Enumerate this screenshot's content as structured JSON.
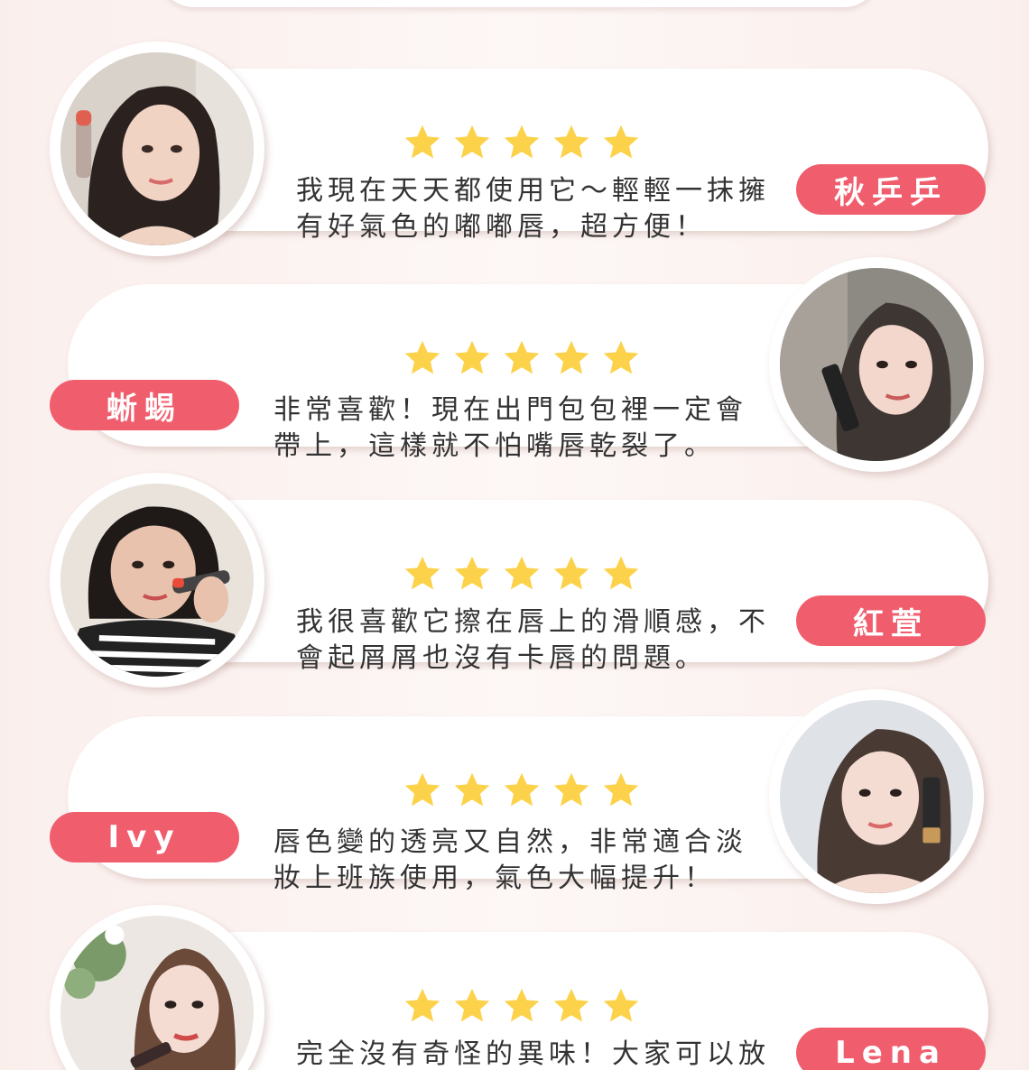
{
  "colors": {
    "background": "#f8eeea",
    "badge": "#f05e6e",
    "star": "#fcd24a",
    "text": "#333333"
  },
  "reviews": [
    {
      "name": "秋乒乒",
      "rating": 5,
      "text": "我現在天天都使用它～輕輕一抹擁\n有好氣色的嘟嘟唇，超方便！"
    },
    {
      "name": "蜥蜴",
      "rating": 5,
      "text": "非常喜歡！現在出門包包裡一定會\n帶上，這樣就不怕嘴唇乾裂了。"
    },
    {
      "name": "紅萓",
      "rating": 5,
      "text": "我很喜歡它擦在唇上的滑順感，不\n會起屑屑也沒有卡唇的問題。"
    },
    {
      "name": "Ivy",
      "rating": 5,
      "text": "唇色變的透亮又自然，非常適合淡\n妝上班族使用，氣色大幅提升！"
    },
    {
      "name": "Lena",
      "rating": 5,
      "text": "完全沒有奇怪的異味！大家可以放\n心的使用～"
    }
  ]
}
